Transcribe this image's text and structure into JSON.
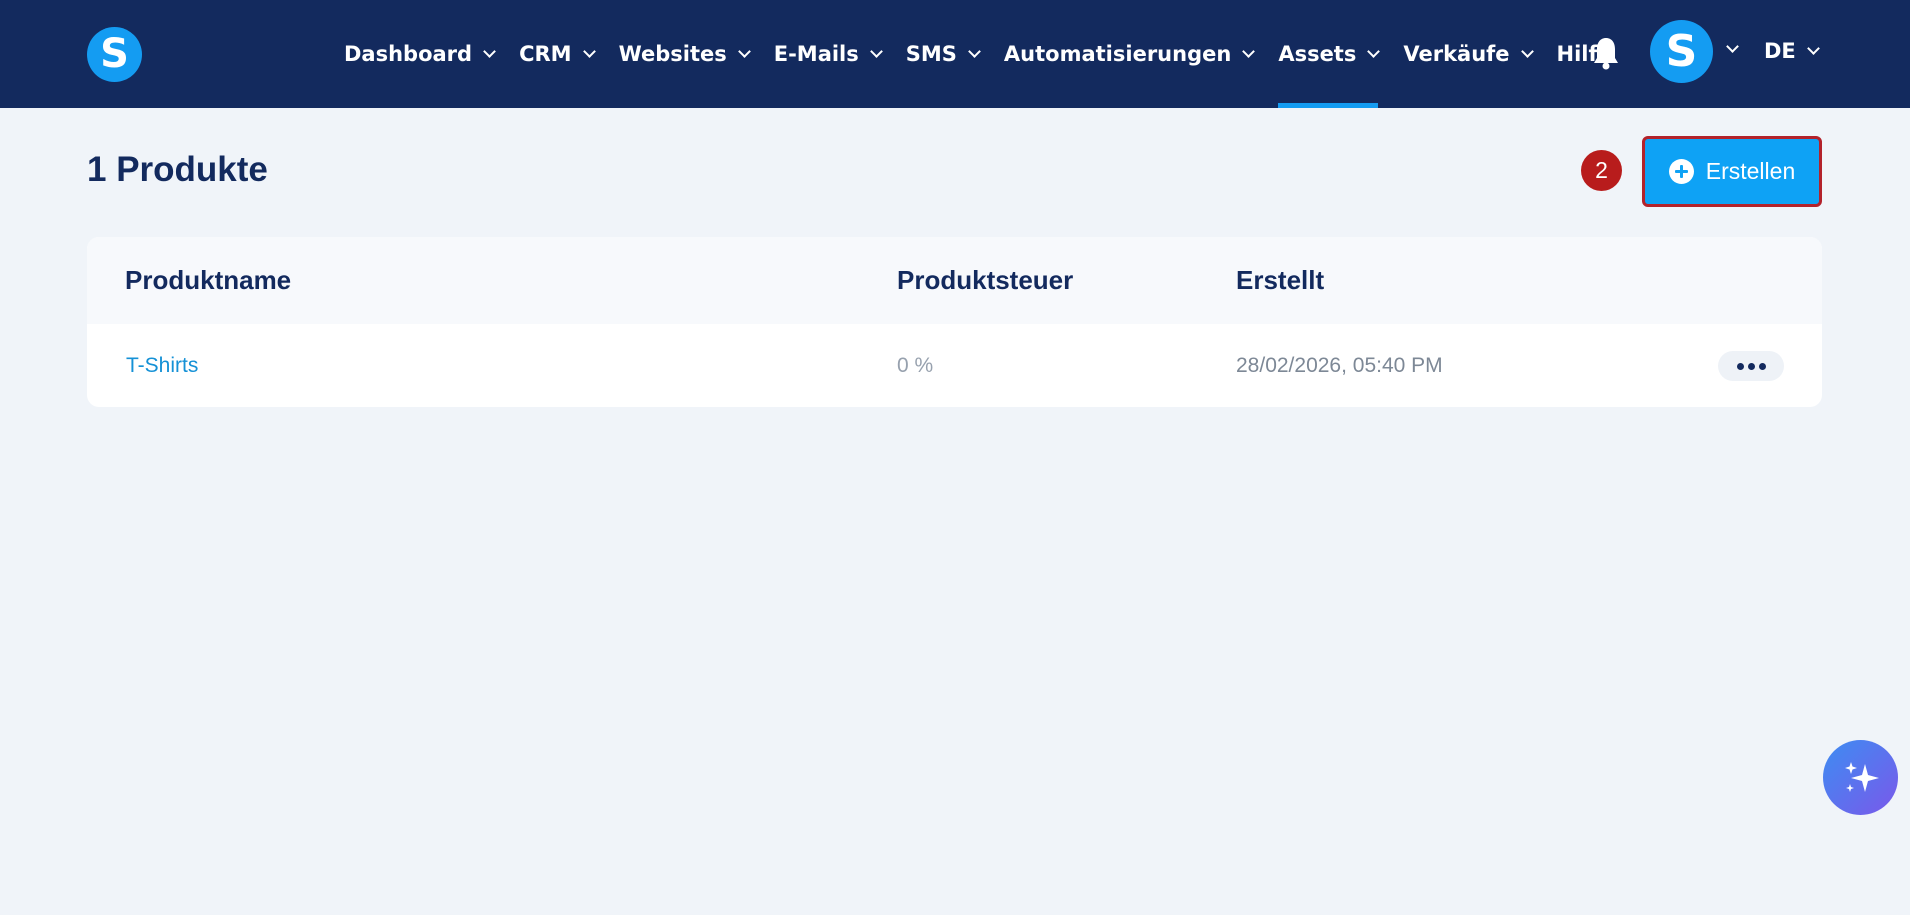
{
  "brand": {
    "logo_letter": "S",
    "accent_color": "#149cf2",
    "nav_bg": "#132a5e"
  },
  "nav": {
    "items": [
      {
        "label": "Dashboard",
        "has_dropdown": true
      },
      {
        "label": "CRM",
        "has_dropdown": true
      },
      {
        "label": "Websites",
        "has_dropdown": true
      },
      {
        "label": "E-Mails",
        "has_dropdown": true
      },
      {
        "label": "SMS",
        "has_dropdown": true
      },
      {
        "label": "Automatisierungen",
        "has_dropdown": true
      },
      {
        "label": "Assets",
        "has_dropdown": true,
        "active": true
      },
      {
        "label": "Verkäufe",
        "has_dropdown": true
      },
      {
        "label": "Hilfe",
        "has_dropdown": false
      }
    ],
    "notifications_icon": "bell-icon",
    "avatar_letter": "S",
    "language": "DE"
  },
  "page": {
    "title": "1 Produkte",
    "step_badge": "2",
    "create_button_label": "Erstellen",
    "create_button_icon": "plus-circle-icon"
  },
  "table": {
    "columns": [
      "Produktname",
      "Produktsteuer",
      "Erstellt"
    ],
    "rows": [
      {
        "name": "T-Shirts",
        "tax": "0 %",
        "created": "28/02/2026, 05:40 PM",
        "actions_icon": "more-horizontal-icon"
      }
    ]
  },
  "fab": {
    "icon": "sparkles-icon",
    "color_start": "#3d8df2",
    "color_end": "#7a58ea"
  }
}
